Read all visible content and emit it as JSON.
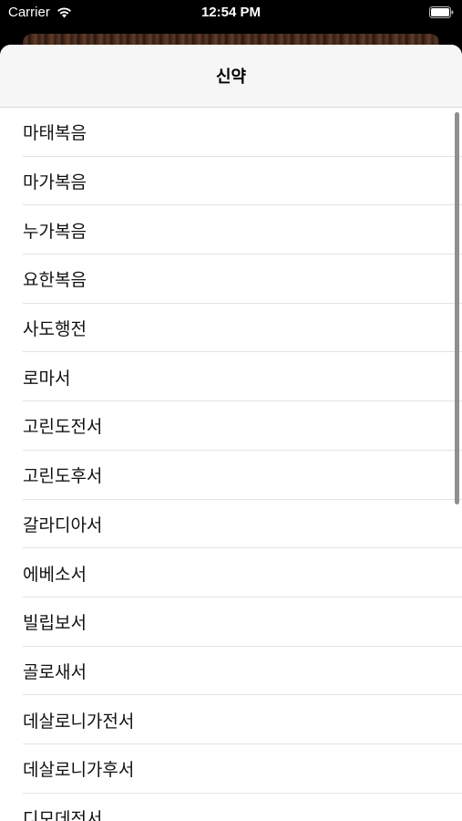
{
  "status_bar": {
    "carrier": "Carrier",
    "time": "12:54 PM"
  },
  "icons": {
    "wifi": "wifi-icon",
    "battery": "battery-icon"
  },
  "nav": {
    "title": "신약"
  },
  "books": [
    "마태복음",
    "마가복음",
    "누가복음",
    "요한복음",
    "사도행전",
    "로마서",
    "고린도전서",
    "고린도후서",
    "갈라디아서",
    "에베소서",
    "빌립보서",
    "골로새서",
    "데살로니가전서",
    "데살로니가후서",
    "디모데전서"
  ],
  "colors": {
    "nav_background": "#f6f6f6",
    "separator": "#e2e2e2",
    "status_bar_background": "#000000"
  }
}
